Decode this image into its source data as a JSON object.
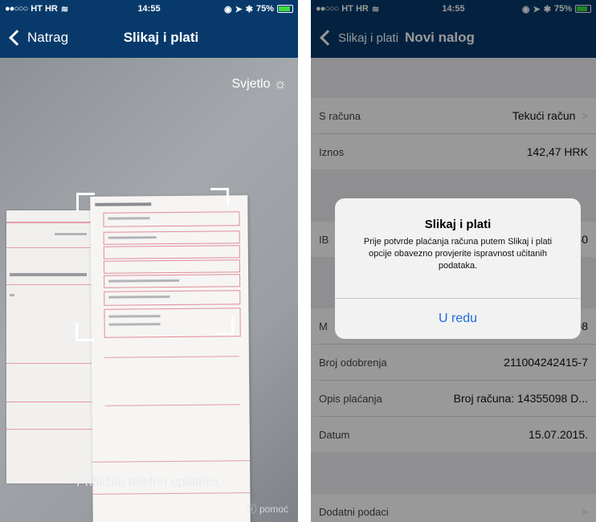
{
  "left_screen": {
    "status": {
      "carrier": "HT HR",
      "time": "14:55",
      "battery": "75%"
    },
    "nav": {
      "back_label": "Natrag",
      "title": "Slikaj i plati"
    },
    "camera": {
      "light_label": "Svjetlo",
      "hint": "Približite telefon uplatnici.",
      "help_label": "pomoć"
    }
  },
  "right_screen": {
    "status": {
      "carrier": "HT HR",
      "time": "14:55",
      "battery": "75%"
    },
    "nav": {
      "back_label": "Slikaj i plati",
      "title": "Novi nalog"
    },
    "rows": [
      {
        "label": "S računa",
        "value": "Tekući račun"
      },
      {
        "label": "Iznos",
        "value": "142,47 HRK"
      },
      {
        "label": "IB",
        "value": "80"
      },
      {
        "label": "M",
        "value": "08"
      },
      {
        "label": "Broj odobrenja",
        "value": "211004242415-7"
      },
      {
        "label": "Opis plaćanja",
        "value": "Broj računa: 14355098 D..."
      },
      {
        "label": "Datum",
        "value": "15.07.2015."
      },
      {
        "label": "Dodatni podaci",
        "value": ""
      }
    ],
    "alert": {
      "title": "Slikaj i plati",
      "message": "Prije potvrde plaćanja računa putem Slikaj i plati opcije obavezno provjerite ispravnost učitanih podataka.",
      "button": "U redu"
    }
  }
}
